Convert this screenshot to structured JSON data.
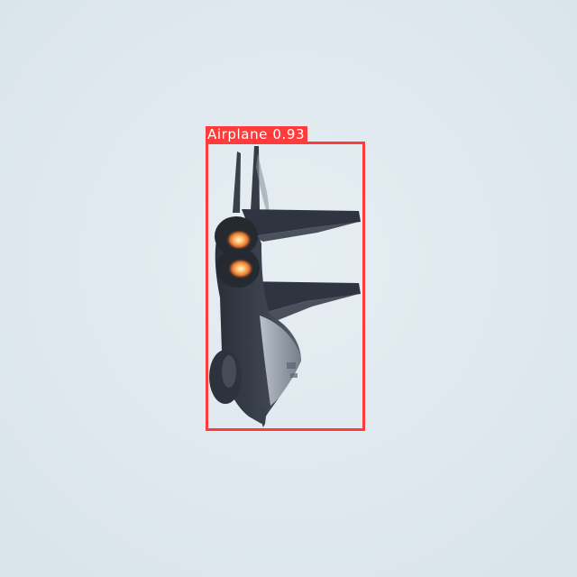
{
  "image": {
    "sky_color": "#dfe9ef",
    "subject": "fighter-jet"
  },
  "detections": [
    {
      "label": "Airplane",
      "confidence": "0.93",
      "box_color": "#ff3b3b"
    }
  ]
}
